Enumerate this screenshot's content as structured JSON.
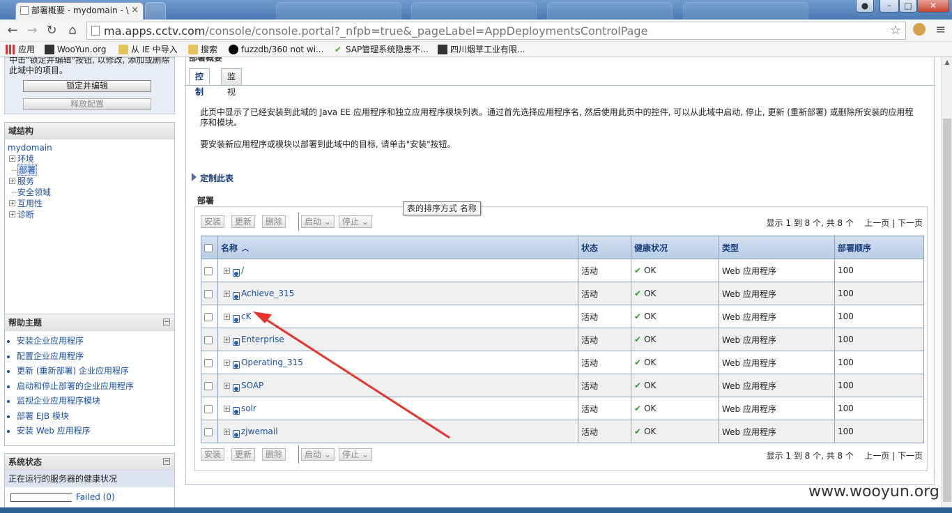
{
  "browser": {
    "tab_title": "部署概要 - mydomain - \\",
    "tab_close": "×",
    "window_controls": {
      "user": "●",
      "minimize": "–",
      "maximize": "□",
      "close": "✕"
    },
    "url_host": "ma.apps.cctv.com",
    "url_path": "/console/console.portal?_nfpb=true&_pageLabel=AppDeploymentsControlPage",
    "bookmarks": [
      {
        "label": "应用",
        "icon": "apps-icon"
      },
      {
        "label": "WooYun.org",
        "icon": "wooyun-icon"
      },
      {
        "label": "从 IE 中导入",
        "icon": "folder-icon"
      },
      {
        "label": "搜索",
        "icon": "folder-icon"
      },
      {
        "label": "fuzzdb/360 not wi...",
        "icon": "github-icon"
      },
      {
        "label": "SAP管理系统隐患不...",
        "icon": "sap-icon"
      },
      {
        "label": "四川烟草工业有限...",
        "icon": "tobacco-icon"
      }
    ]
  },
  "change_center": {
    "text": "中击\"锁定并编辑\"按钮, 以修改, 添加或删除此域中的项目。",
    "lock_button": "锁定并编辑",
    "release_button": "释放配置"
  },
  "domain_structure": {
    "title": "域结构",
    "root": "mydomain",
    "items": [
      "环境",
      "部署",
      "服务",
      "安全领域",
      "互用性",
      "诊断"
    ]
  },
  "help_topics": {
    "title": "帮助主题",
    "items": [
      "安装企业应用程序",
      "配置企业应用程序",
      "更新 (重新部署) 企业应用程序",
      "启动和停止部署的企业应用程序",
      "监视企业应用程序模块",
      "部署 EJB 模块",
      "安装 Web 应用程序"
    ]
  },
  "system_status": {
    "title": "系统状态",
    "subtitle": "正在运行的服务器的健康状况",
    "failed": "Failed (0)"
  },
  "content": {
    "header": "部署概要",
    "tabs": [
      "控制",
      "监视"
    ],
    "intro1": "此页中显示了已经安装到此域的 Java EE 应用程序和独立应用程序模块列表。通过首先选择应用程序名, 然后使用此页中的控件, 可以从此域中启动, 停止, 更新 (重新部署) 或删除所安装的应用程序和模块。",
    "intro2": "要安装新应用程序或模块以部署到此域中的目标, 请单击\"安装\"按钮。",
    "customize": "定制此表",
    "section_label": "部署",
    "buttons": {
      "install": "安装",
      "update": "更新",
      "delete": "删除",
      "start": "启动",
      "stop": "停止"
    },
    "pager": {
      "showing": "显示 1 到 8 个, 共 8 个",
      "prev": "上一页",
      "sep": "|",
      "next": "下一页"
    },
    "columns": [
      "名称",
      "状态",
      "健康状况",
      "类型",
      "部署顺序"
    ],
    "rows": [
      {
        "name": "/",
        "state": "活动",
        "health": "OK",
        "type": "Web 应用程序",
        "order": "100"
      },
      {
        "name": "Achieve_315",
        "state": "活动",
        "health": "OK",
        "type": "Web 应用程序",
        "order": "100"
      },
      {
        "name": "cK",
        "state": "活动",
        "health": "OK",
        "type": "Web 应用程序",
        "order": "100"
      },
      {
        "name": "Enterprise",
        "state": "活动",
        "health": "OK",
        "type": "Web 应用程序",
        "order": "100"
      },
      {
        "name": "Operating_315",
        "state": "活动",
        "health": "OK",
        "type": "Web 应用程序",
        "order": "100"
      },
      {
        "name": "SOAP",
        "state": "活动",
        "health": "OK",
        "type": "Web 应用程序",
        "order": "100"
      },
      {
        "name": "solr",
        "state": "活动",
        "health": "OK",
        "type": "Web 应用程序",
        "order": "100"
      },
      {
        "name": "zjwemail",
        "state": "活动",
        "health": "OK",
        "type": "Web 应用程序",
        "order": "100"
      }
    ],
    "tooltip": "表的排序方式 名称"
  },
  "annotation_color": "#e8332a",
  "watermark": "www.wooyun.org"
}
